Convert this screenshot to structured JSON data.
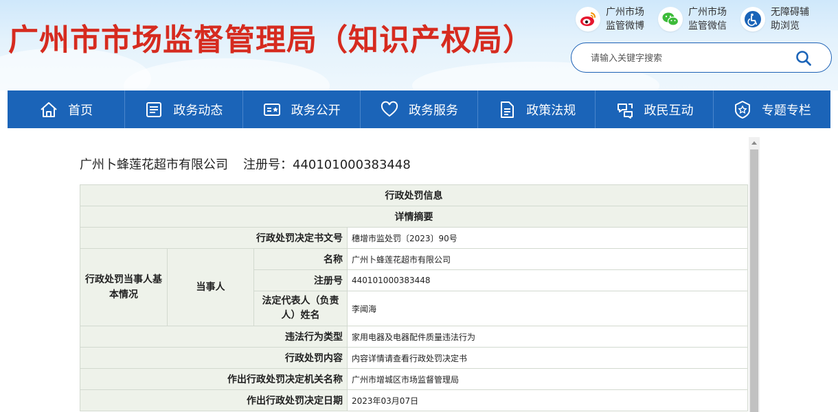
{
  "header": {
    "title": "广州市市场监督管理局（知识产权局）",
    "quick_links": [
      {
        "icon": "weibo-icon",
        "label": "广州市场监管微博"
      },
      {
        "icon": "wechat-icon",
        "label": "广州市场监管微信"
      },
      {
        "icon": "accessibility-icon",
        "label": "无障碍辅助浏览"
      }
    ],
    "search": {
      "placeholder": "请输入关键字搜索",
      "icon": "search-icon"
    }
  },
  "nav": {
    "items": [
      {
        "label": "首页",
        "icon": "home-icon"
      },
      {
        "label": "政务动态",
        "icon": "news-icon"
      },
      {
        "label": "政务公开",
        "icon": "public-card-icon"
      },
      {
        "label": "政务服务",
        "icon": "heart-icon"
      },
      {
        "label": "政策法规",
        "icon": "document-icon"
      },
      {
        "label": "政民互动",
        "icon": "interaction-icon"
      },
      {
        "label": "专题专栏",
        "icon": "star-badge-icon"
      }
    ]
  },
  "record": {
    "company": "广州卜蜂莲花超市有限公司",
    "reg_label": "注册号：440101000383448"
  },
  "table": {
    "section_title": "行政处罚信息",
    "subsection_title": "详情摘要",
    "decision_no": {
      "label": "行政处罚决定书文号",
      "value": "穗增市监处罚〔2023〕90号"
    },
    "party_group": "行政处罚当事人基本情况",
    "party_sub": "当事人",
    "party_name": {
      "label": "名称",
      "value": "广州卜蜂莲花超市有限公司"
    },
    "party_reg": {
      "label": "注册号",
      "value": "440101000383448"
    },
    "party_rep": {
      "label": "法定代表人（负责人）姓名",
      "value": "李闻海"
    },
    "violation_type": {
      "label": "违法行为类型",
      "value": "家用电器及电器配件质量违法行为"
    },
    "penalty_content": {
      "label": "行政处罚内容",
      "value": "内容详情请查看行政处罚决定书"
    },
    "authority": {
      "label": "作出行政处罚决定机关名称",
      "value": "广州市增城区市场监督管理局"
    },
    "decision_date": {
      "label": "作出行政处罚决定日期",
      "value": "2023年03月07日"
    }
  },
  "colors": {
    "title_red": "#d62b1f",
    "nav_blue": "#1b64b8",
    "label_bg": "#eef2ea",
    "border": "#d2d9cf"
  }
}
